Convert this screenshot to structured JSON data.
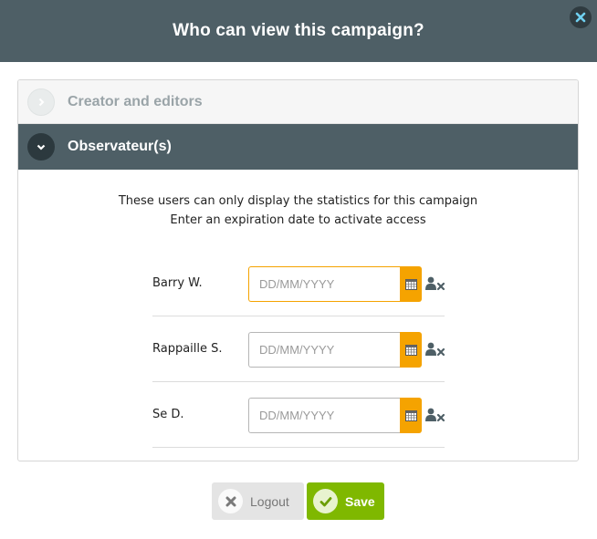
{
  "modal": {
    "title": "Who can view this campaign?",
    "close_icon": "close-icon"
  },
  "accordion": {
    "sections": [
      {
        "label": "Creator and editors",
        "state": "collapsed",
        "icon": "chevron-right-icon"
      },
      {
        "label": "Observateur(s)",
        "state": "expanded",
        "icon": "chevron-down-icon"
      }
    ]
  },
  "observers": {
    "description_line1": "These users can only display the statistics for this campaign",
    "description_line2": "Enter an expiration date to activate access",
    "date_placeholder": "DD/MM/YYYY",
    "calendar_icon": "calendar-icon",
    "remove_icon": "remove-user-icon",
    "users": [
      {
        "name": "Barry W.",
        "date": ""
      },
      {
        "name": "Rappaille S.",
        "date": ""
      },
      {
        "name": "Se D.",
        "date": ""
      }
    ]
  },
  "footer": {
    "logout_label": "Logout",
    "logout_icon": "x-icon",
    "save_label": "Save",
    "save_icon": "check-icon"
  },
  "colors": {
    "header_bg": "#4e5f66",
    "accent_orange": "#f5a300",
    "save_green": "#7fb800"
  }
}
